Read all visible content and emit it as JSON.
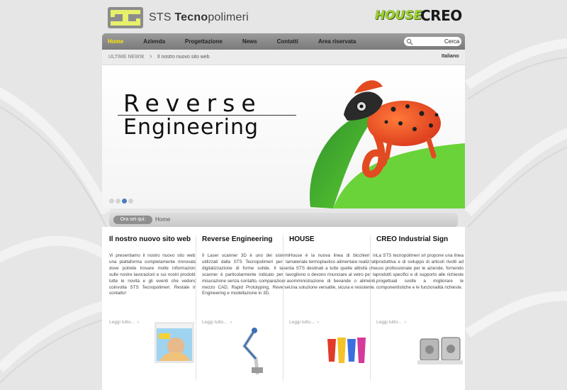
{
  "brand": {
    "logo_name": "STS",
    "logo_bold": "Tecno",
    "logo_rest": "polimeri",
    "partner1": "HOUSE",
    "partner2": "CREO"
  },
  "nav": {
    "items": [
      "Home",
      "Azienda",
      "Progettazione",
      "News",
      "Contatti",
      "Area riservata"
    ],
    "active": "Home"
  },
  "search": {
    "placeholder": "",
    "button": "Cerca"
  },
  "ticker": {
    "label": "ULTIME NEWS:",
    "text": "Il nostro nuovo sito web",
    "language": "Italiano"
  },
  "hero": {
    "title_line1": "Reverse",
    "title_line2": "Engineering",
    "slide_count": 4,
    "active_slide": 3
  },
  "breadcrumb": {
    "label": "Ora sei qui:",
    "current": "Home"
  },
  "columns": [
    {
      "title": "Il nostro nuovo sito web",
      "body": "Vi presentiamo il nostro nuovo sito web, una piattaforma completamente rinnovata dove potrete trovare molte informazioni sulle nostre lavorazioni e sui nostri prodotti, tutte le novità e gli eventi che vedono coinvolta STS Tecnopolimeri. Restate in contatto!",
      "readmore": "Leggi tutto..."
    },
    {
      "title": "Reverse Engineering",
      "body": "Il Laser scanner 3D è uno dei sistemi utilizzati dalla STS Tecnopolimeri per la digitalizzazione di forme solide. Il laser scanner è particolarmente indicato per la misurazione senza contatto, comparazioni a mezzo CAD, Rapid Prototyping, Reverse Engineering e modellazione in 3D.",
      "readmore": "Leggi tutto..."
    },
    {
      "title": "HOUSE",
      "body": "House è la nuova linea di bicchieri in materiale termoplastico alimentare realizzati da STS destinati a tutte quelle attività che vogliono o devono rinunciare al vetro per la somministrazione di bevande o alimenti. Una soluzione versatile, sicura e resistente.",
      "readmore": "Leggi tutto..."
    },
    {
      "title": "CREO Industrial Sign",
      "body": "La STS tecnopolimeri srl propone una linea produttiva e di sviluppo di articoli rivolti ad uso professionale per le aziende, fornendo prodotti specifici e di supporto alle richieste progettuali svolte a migliorare le componentistiche e le funzionalità richieste.",
      "readmore": "Leggi tutto..."
    }
  ],
  "colors": {
    "nav_active": "#ffe800",
    "house_green": "#9ed12f",
    "slide_active": "#4a7fbf"
  }
}
